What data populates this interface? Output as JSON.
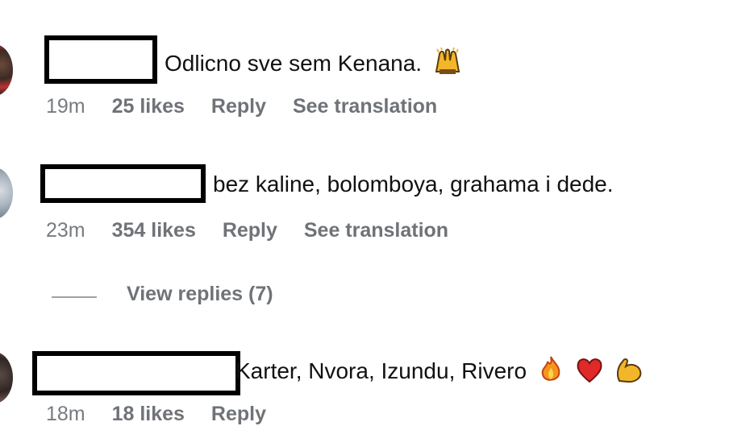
{
  "comments": [
    {
      "text": "Odlicno sve sem Kenana.",
      "emojis": [
        "raising-hands-emoji"
      ],
      "time": "19m",
      "likes": "25 likes",
      "reply": "Reply",
      "translate": "See translation"
    },
    {
      "text": "bez kaline, bolomboya, grahama i dede.",
      "time": "23m",
      "likes": "354 likes",
      "reply": "Reply",
      "translate": "See translation",
      "view_replies": "View replies (7)"
    },
    {
      "text": "Karter, Nvora, Izundu, Rivero",
      "emojis": [
        "fire-emoji",
        "red-heart-emoji",
        "flexed-biceps-emoji"
      ],
      "time": "18m",
      "likes": "18 likes",
      "reply": "Reply"
    }
  ]
}
